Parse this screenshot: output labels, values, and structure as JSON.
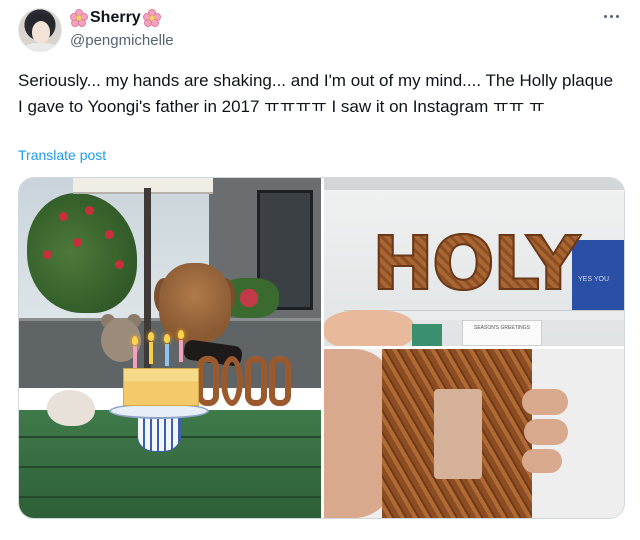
{
  "user": {
    "display_name": "Sherry",
    "handle": "@pengmichelle"
  },
  "tweet": {
    "text": "Seriously... my hands are shaking... and I'm out of my mind.... The Holly plaque I gave to Yoongi's father in 2017 ㅠㅠㅠㅠ I saw it on Instagram ㅠㅠ ㅠ",
    "translate_label": "Translate post"
  },
  "media": {
    "top_right_sign": "HOLY",
    "card_text": "SEASON'S GREETINGS",
    "box_text": "YES YOU"
  },
  "icons": {
    "more": "more-dots-icon",
    "name_emoji": "cherry-blossom-icon"
  },
  "colors": {
    "link": "#1d9bf0",
    "secondary_text": "#536471",
    "primary_text": "#0f1419"
  }
}
